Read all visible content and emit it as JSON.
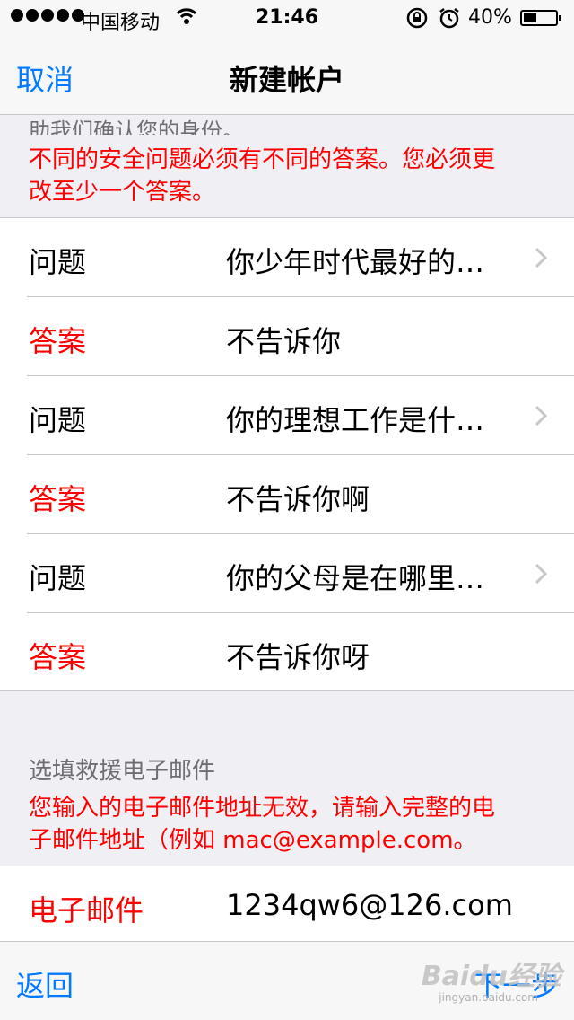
{
  "status_bar": {
    "carrier": "中国移动",
    "time": "21:46",
    "battery_percent": "40%",
    "battery_level": 0.4
  },
  "nav": {
    "cancel_label": "取消",
    "title": "新建帐户"
  },
  "security": {
    "header_partial": "助我们确认您的身份。",
    "error_line1": "不同的安全问题必须有不同的答案。您必须更",
    "error_line2": "改至少一个答案。",
    "rows": [
      {
        "label": "问题",
        "value": "你少年时代最好的…"
      },
      {
        "label": "答案",
        "value": "不告诉你"
      },
      {
        "label": "问题",
        "value": "你的理想工作是什…"
      },
      {
        "label": "答案",
        "value": "不告诉你啊"
      },
      {
        "label": "问题",
        "value": "你的父母是在哪里…"
      },
      {
        "label": "答案",
        "value": "不告诉你呀"
      }
    ]
  },
  "rescue_email": {
    "header": "选填救援电子邮件",
    "error_line1": "您输入的电子邮件地址无效，请输入完整的电",
    "error_line2": "子邮件地址（例如 mac@example.com。",
    "field_label": "电子邮件",
    "field_value": "1234qw6@126.com"
  },
  "toolbar": {
    "back_label": "返回",
    "next_label": "下一步"
  },
  "watermark": {
    "brand": "Baidu经验",
    "url": "jingyan.baidu.com"
  },
  "icons": {
    "chevron": "chevron-right-icon",
    "wifi": "wifi-icon",
    "lock": "rotation-lock-icon",
    "alarm": "alarm-icon",
    "battery": "battery-icon"
  },
  "colors": {
    "accent": "#007aff",
    "error": "#ff0000",
    "background": "#efeff4"
  }
}
